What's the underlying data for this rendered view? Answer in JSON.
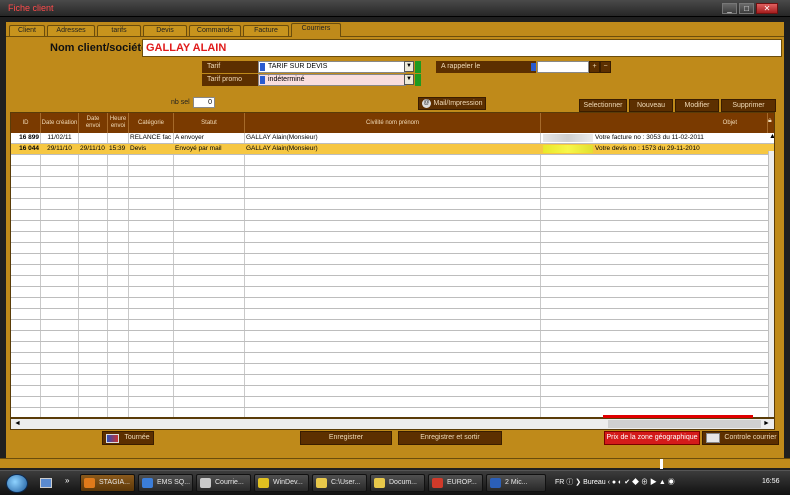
{
  "window": {
    "title": "Fiche client"
  },
  "tabs": [
    {
      "label": "Client"
    },
    {
      "label": "Adresses"
    },
    {
      "label": "tarifs"
    },
    {
      "label": "Devis"
    },
    {
      "label": "Commande"
    },
    {
      "label": "Facture"
    },
    {
      "label": "Courriers",
      "active": true
    }
  ],
  "header": {
    "nom_label": "Nom client/société",
    "nom_value": "GALLAY ALAIN"
  },
  "tarif": {
    "label": "Tarif",
    "value": "TARIF SUR DEVIS"
  },
  "tarif_promo": {
    "label": "Tarif promo",
    "value": "indéterminé"
  },
  "rappel": {
    "label": "A rappeler le",
    "plus": "+",
    "minus": "−"
  },
  "nbsel": {
    "label": "nb sel",
    "value": "0"
  },
  "buttons": {
    "mail": "Mail/Impression",
    "selectionner": "Selectionner",
    "nouveau": "Nouveau",
    "modifier": "Modifier",
    "supprimer": "Supprimer",
    "tournee": "Tournée",
    "enregistrer": "Enregistrer",
    "enregistrer_sortir": "Enregistrer et sortir",
    "prix_zone": "Prix de la zone géographique",
    "controle": "Controle courrier"
  },
  "table": {
    "headers": [
      "ID",
      "Date création",
      "Date envoi",
      "Heure envoi",
      "Catégorie",
      "Statut",
      "Civilité nom prénom",
      "Objet"
    ],
    "rows": [
      {
        "id": "16 899",
        "creation": "11/02/11",
        "envoi": "",
        "heure": "",
        "categorie": "RELANCE fac",
        "statut": "A envoyer",
        "nom": "GALLAY Alain(Monsieur)",
        "objet": "Votre  facture no : 3053 du 11-02-2011"
      },
      {
        "id": "16 044",
        "creation": "29/11/10",
        "envoi": "29/11/10",
        "heure": "15:39",
        "categorie": "Devis",
        "statut": "Envoyé par mail",
        "nom": "GALLAY Alain(Monsieur)",
        "objet": "Votre  devis no : 1573 du 29-11-2010",
        "selected": true
      }
    ]
  },
  "taskbar": {
    "items": [
      "STAGIA...",
      "EMS SQ...",
      "Courrie...",
      "WinDev...",
      "C:\\User...",
      "Docum...",
      "EUROP...",
      "2 Mic..."
    ],
    "lang": "FR",
    "bureau": "Bureau",
    "clock": "16:56"
  },
  "colors": {
    "panel": "#bf8a1a",
    "header_dark": "#7a3a00",
    "selected_row": "#f6c742",
    "accent_red": "#d41a1a"
  }
}
